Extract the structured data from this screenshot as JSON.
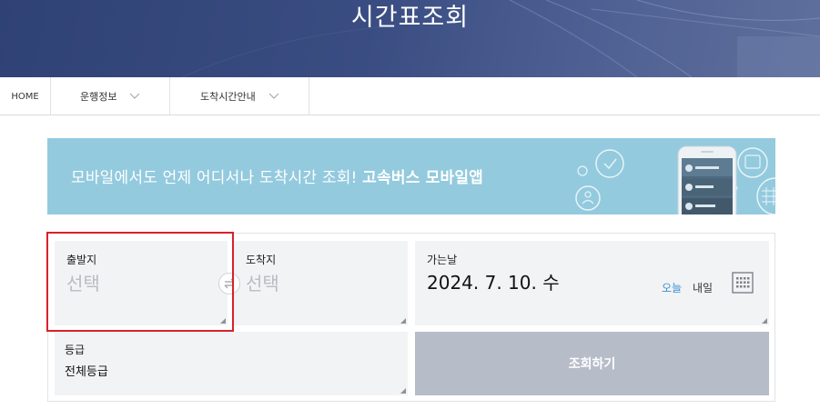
{
  "header": {
    "title": "시간표조회"
  },
  "subnav": {
    "home": "HOME",
    "menu1": "운행정보",
    "menu2": "도착시간안내"
  },
  "banner": {
    "text": "모바일에서도 언제 어디서나 도착시간 조회! ",
    "text_bold": "고속버스 모바일앱"
  },
  "form": {
    "departure": {
      "label": "출발지",
      "placeholder": "선택"
    },
    "arrival": {
      "label": "도착지",
      "placeholder": "선택"
    },
    "date": {
      "label": "가는날",
      "value": "2024. 7. 10. 수",
      "today": "오늘",
      "tomorrow": "내일"
    },
    "grade": {
      "label": "등급",
      "value": "전체등급"
    },
    "search_button": "조회하기"
  },
  "colors": {
    "hero": "#3a4d82",
    "banner": "#93cade",
    "today_link": "#3a8fd0",
    "search_button": "#b7bcc9",
    "highlight": "#d9202b"
  }
}
